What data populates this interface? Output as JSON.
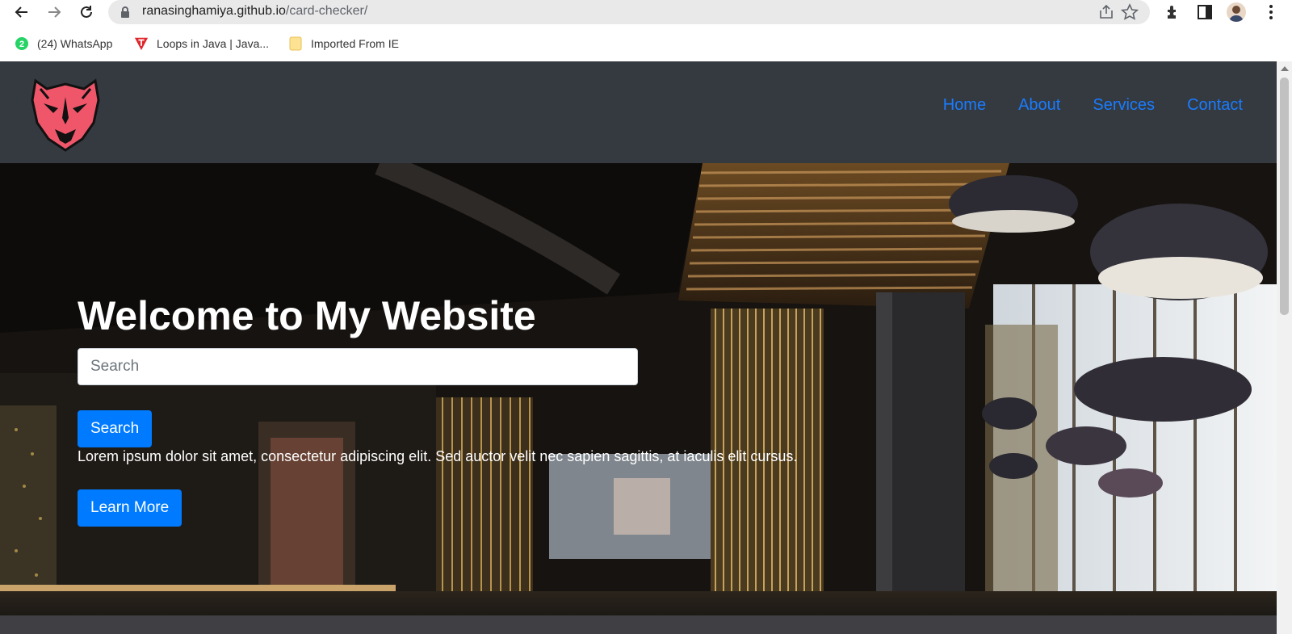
{
  "browser": {
    "url_host": "ranasinghamiya.github.io",
    "url_path": "/card-checker/",
    "bookmarks": [
      {
        "label": "(24) WhatsApp",
        "icon": "whatsapp-icon",
        "badge": "2"
      },
      {
        "label": "Loops in Java | Java...",
        "icon": "tutorial-site-icon"
      },
      {
        "label": "Imported From IE",
        "icon": "folder-icon"
      }
    ]
  },
  "navbar": {
    "logo": "panther-logo",
    "links": [
      "Home",
      "About",
      "Services",
      "Contact"
    ]
  },
  "hero": {
    "title": "Welcome to My Website",
    "search_placeholder": "Search",
    "search_button": "Search",
    "text": "Lorem ipsum dolor sit amet, consectetur adipiscing elit. Sed auctor velit nec sapien sagittis, at iaculis elit cursus.",
    "learn_more_button": "Learn More"
  },
  "colors": {
    "navbar_bg": "#343a40",
    "link": "#1a7cff",
    "primary_button": "#007bff",
    "logo_pink": "#f0566a"
  }
}
